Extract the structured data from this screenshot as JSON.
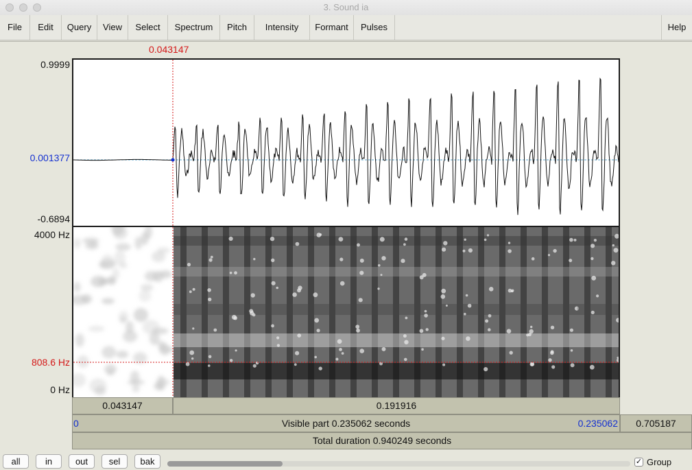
{
  "window": {
    "title": "3. Sound ia"
  },
  "menu": [
    "File",
    "Edit",
    "Query",
    "View",
    "Select",
    "Spectrum",
    "Pitch",
    "Intensity",
    "Formant",
    "Pulses"
  ],
  "help_label": "Help",
  "cursor": {
    "time": "0.043147",
    "time_fraction": 0.1835
  },
  "waveform": {
    "max_label": "0.9999",
    "zero_label": "0.001377",
    "min_label": "-0.6894",
    "max_value": 0.9999,
    "min_value": -0.6894,
    "zero_value": 0.001377
  },
  "spectrogram": {
    "top_label": "4000 Hz",
    "bottom_label": "0 Hz",
    "cursor_label": "808.6 Hz",
    "max_hz": 4000,
    "cursor_hz": 808.6
  },
  "selection": {
    "left_duration": "0.043147",
    "right_duration": "0.191916"
  },
  "visible": {
    "start": "0",
    "text": "Visible part 0.235062 seconds",
    "end": "0.235062",
    "after": "0.705187"
  },
  "total": {
    "text": "Total duration 0.940249 seconds"
  },
  "buttons": {
    "all": "all",
    "in": "in",
    "out": "out",
    "sel": "sel",
    "bak": "bak"
  },
  "group": {
    "label": "Group",
    "checked": true,
    "check_mark": "✓"
  },
  "scroll": {
    "position_fraction": 0.0,
    "size_fraction": 0.25
  },
  "colors": {
    "cursor": "#d41818",
    "zero_line": "#1430d0",
    "selection_bar": "#c2c2ae",
    "waveform": "#111111"
  }
}
